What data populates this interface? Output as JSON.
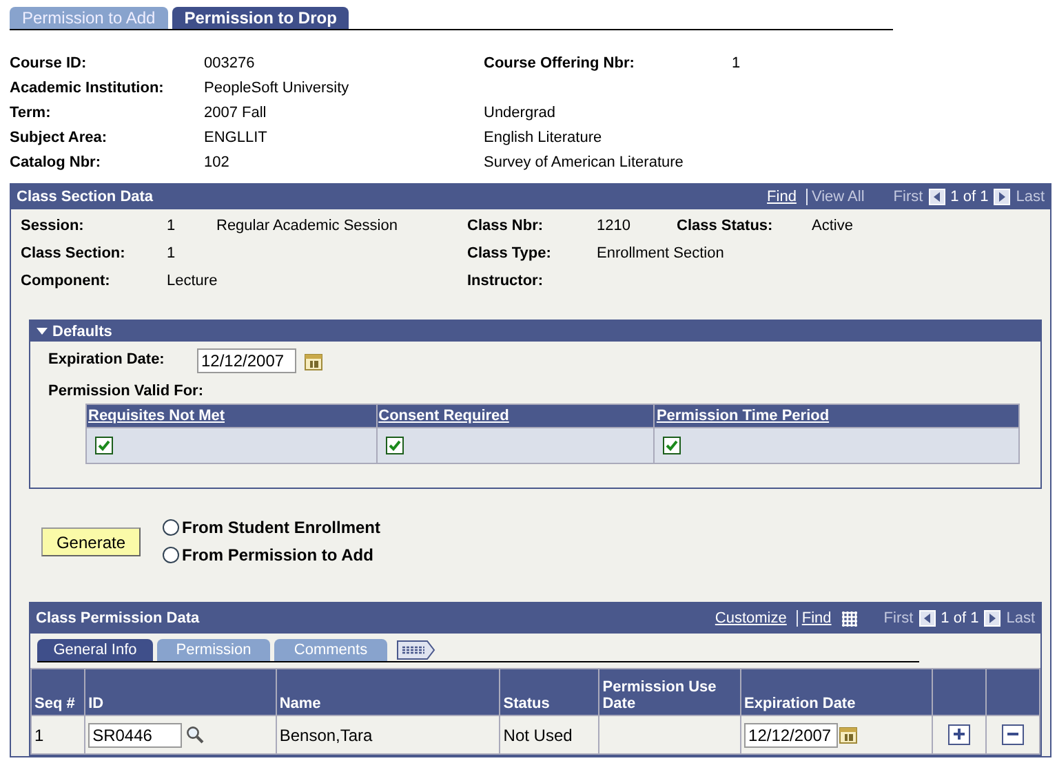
{
  "page_tabs": [
    {
      "label": "Permission to Add",
      "selected": false
    },
    {
      "label": "Permission to Drop",
      "selected": true
    }
  ],
  "course_info": [
    {
      "label": "Course ID:",
      "value": "003276",
      "label2": "Course Offering Nbr:",
      "value2": "1"
    },
    {
      "label": "Academic Institution:",
      "value": "PeopleSoft University"
    },
    {
      "label": "Term:",
      "value": "2007 Fall",
      "value2": "Undergrad"
    },
    {
      "label": "Subject Area:",
      "value": "ENGLLIT",
      "value2": "English Literature"
    },
    {
      "label": "Catalog Nbr:",
      "value": "102",
      "value2": "Survey of American Literature"
    }
  ],
  "class_section": {
    "title": "Class Section Data",
    "links": [
      {
        "label": "Find",
        "disabled": false
      },
      {
        "label": "View All",
        "disabled": true
      }
    ],
    "first": "First",
    "count": "1 of 1",
    "last": "Last",
    "fields": [
      {
        "label": "Session:",
        "value": "1",
        "description": "Regular Academic Session",
        "label2": "Class Nbr:",
        "value2": "1210",
        "label3": "Class Status:",
        "value3": "Active"
      },
      {
        "label": "Class Section:",
        "value": "1",
        "label2": "Class Type:",
        "value2": "Enrollment Section"
      },
      {
        "label": "Component:",
        "value": "Lecture",
        "label2": "Instructor:"
      }
    ],
    "defaults": {
      "title": "Defaults",
      "expanded": true,
      "expiration_label": "Expiration Date:",
      "expiration_date": "12/12/2007",
      "valid_for_label": "Permission Valid For:",
      "valid_for": [
        {
          "label": "Requisites Not Met",
          "checked": true
        },
        {
          "label": "Consent Required",
          "checked": true
        },
        {
          "label": "Permission Time Period",
          "checked": true
        }
      ]
    },
    "generate_button": "Generate",
    "sources": [
      {
        "label": "From Student Enrollment",
        "selected": false
      },
      {
        "label": "From Permission to Add",
        "selected": false
      }
    ]
  },
  "class_permission": {
    "title": "Class Permission Data",
    "links": [
      {
        "label": "Customize",
        "disabled": false
      },
      {
        "label": "Find",
        "disabled": false
      }
    ],
    "first": "First",
    "count": "1 of 1",
    "last": "Last",
    "tabs": [
      {
        "label": "General Info",
        "selected": true
      },
      {
        "label": "Permission",
        "selected": false
      },
      {
        "label": "Comments",
        "selected": false
      }
    ],
    "columns": [
      "Seq #",
      "ID",
      "Name",
      "Status",
      "Permission Use Date",
      "Expiration Date"
    ],
    "rows": [
      {
        "seq": "1",
        "id": "SR0446",
        "name": "Benson,Tara",
        "status": "Not Used",
        "expiration_date": "12/12/2007"
      }
    ]
  }
}
